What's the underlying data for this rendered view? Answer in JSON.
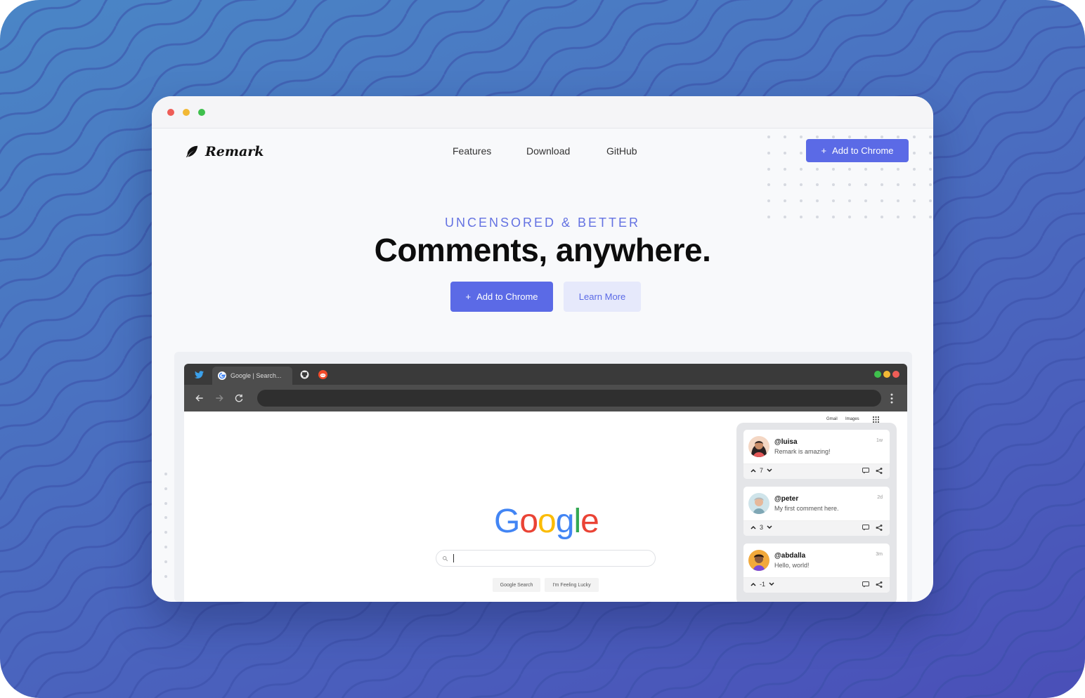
{
  "window": {
    "dots": [
      "close",
      "minimize",
      "zoom"
    ]
  },
  "site": {
    "logo_text": "Remark",
    "nav": [
      "Features",
      "Download",
      "GitHub"
    ],
    "header_cta": "Add to Chrome",
    "eyebrow": "UNCENSORED & BETTER",
    "headline": "Comments, anywhere.",
    "cta_primary": "Add to Chrome",
    "cta_secondary": "Learn More",
    "plus_glyph": "+"
  },
  "demo_browser": {
    "tab_title": "Google | Search...",
    "google": {
      "top_links": [
        "Gmail",
        "Images"
      ],
      "buttons": [
        "Google Search",
        "I'm Feeling Lucky"
      ]
    }
  },
  "comments": [
    {
      "user": "@luisa",
      "text": "Remark is amazing!",
      "time": "1w",
      "score": "7"
    },
    {
      "user": "@peter",
      "text": "My first comment here.",
      "time": "2d",
      "score": "3"
    },
    {
      "user": "@abdalla",
      "text": "Hello, world!",
      "time": "3m",
      "score": "-1"
    }
  ],
  "colors": {
    "accent": "#5b6ae6",
    "accent_light": "#e6e9fb",
    "background_top": "#4a86c6",
    "background_bottom": "#4a4fb8"
  }
}
